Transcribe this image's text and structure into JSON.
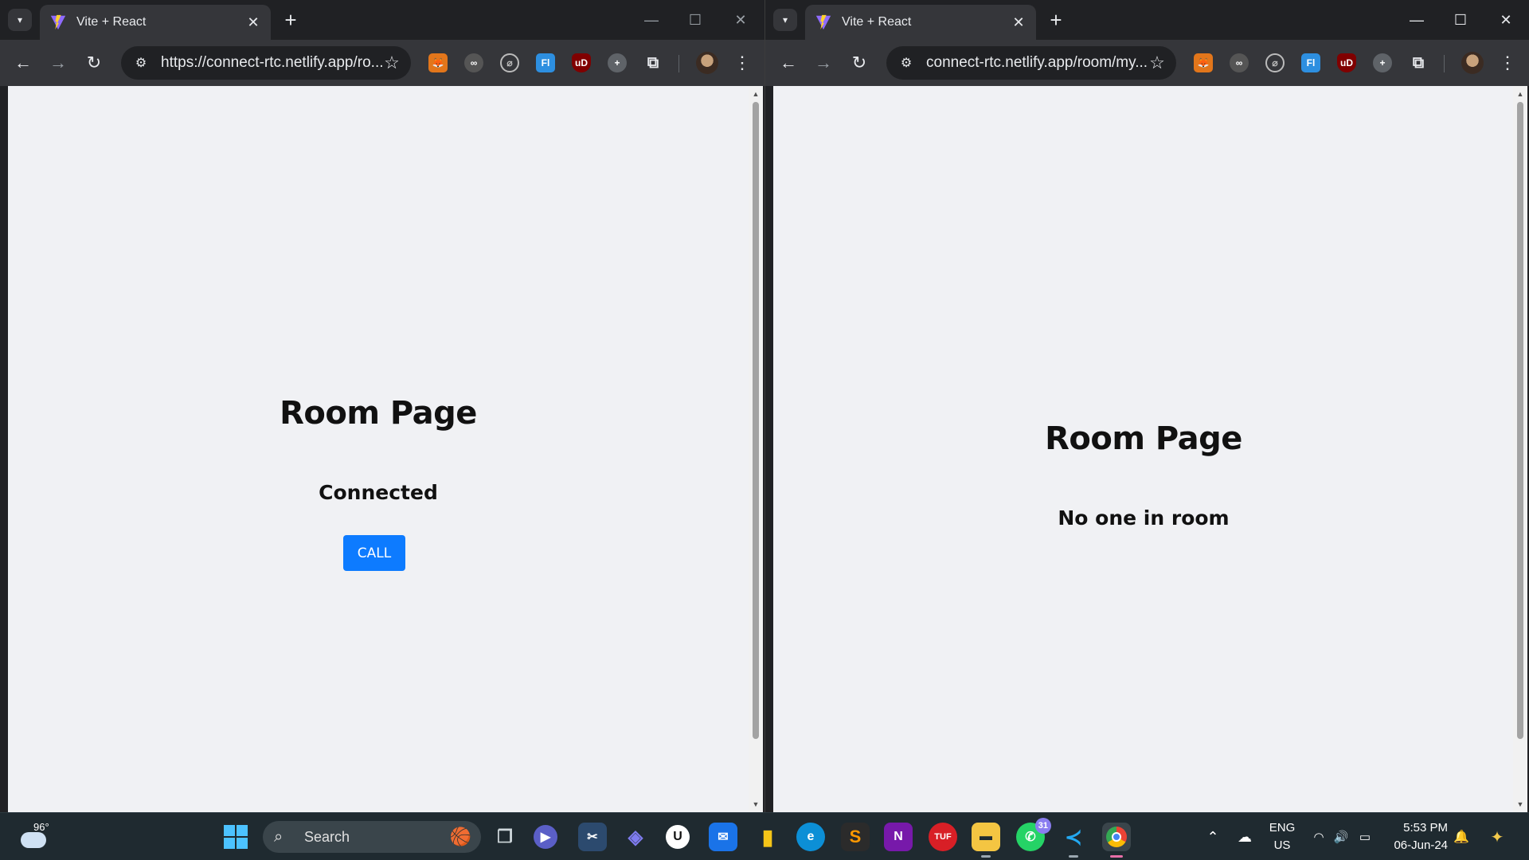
{
  "windows": [
    {
      "tab_title": "Vite + React",
      "url": "https://connect-rtc.netlify.app/ro...",
      "heading": "Room Page",
      "status": "Connected",
      "call_button": "CALL"
    },
    {
      "tab_title": "Vite + React",
      "url": "connect-rtc.netlify.app/room/my...",
      "heading": "Room Page",
      "status": "No one in room"
    }
  ],
  "taskbar": {
    "weather_temp": "96°",
    "search_placeholder": "Search",
    "whatsapp_badge": "31",
    "lang_line1": "ENG",
    "lang_line2": "US",
    "time": "5:53 PM",
    "date": "06-Jun-24"
  },
  "colors": {
    "call_button": "#0d7bff",
    "page_background": "#f0f1f4",
    "browser_chrome": "#35363a",
    "taskbar": "#1f2a30"
  }
}
